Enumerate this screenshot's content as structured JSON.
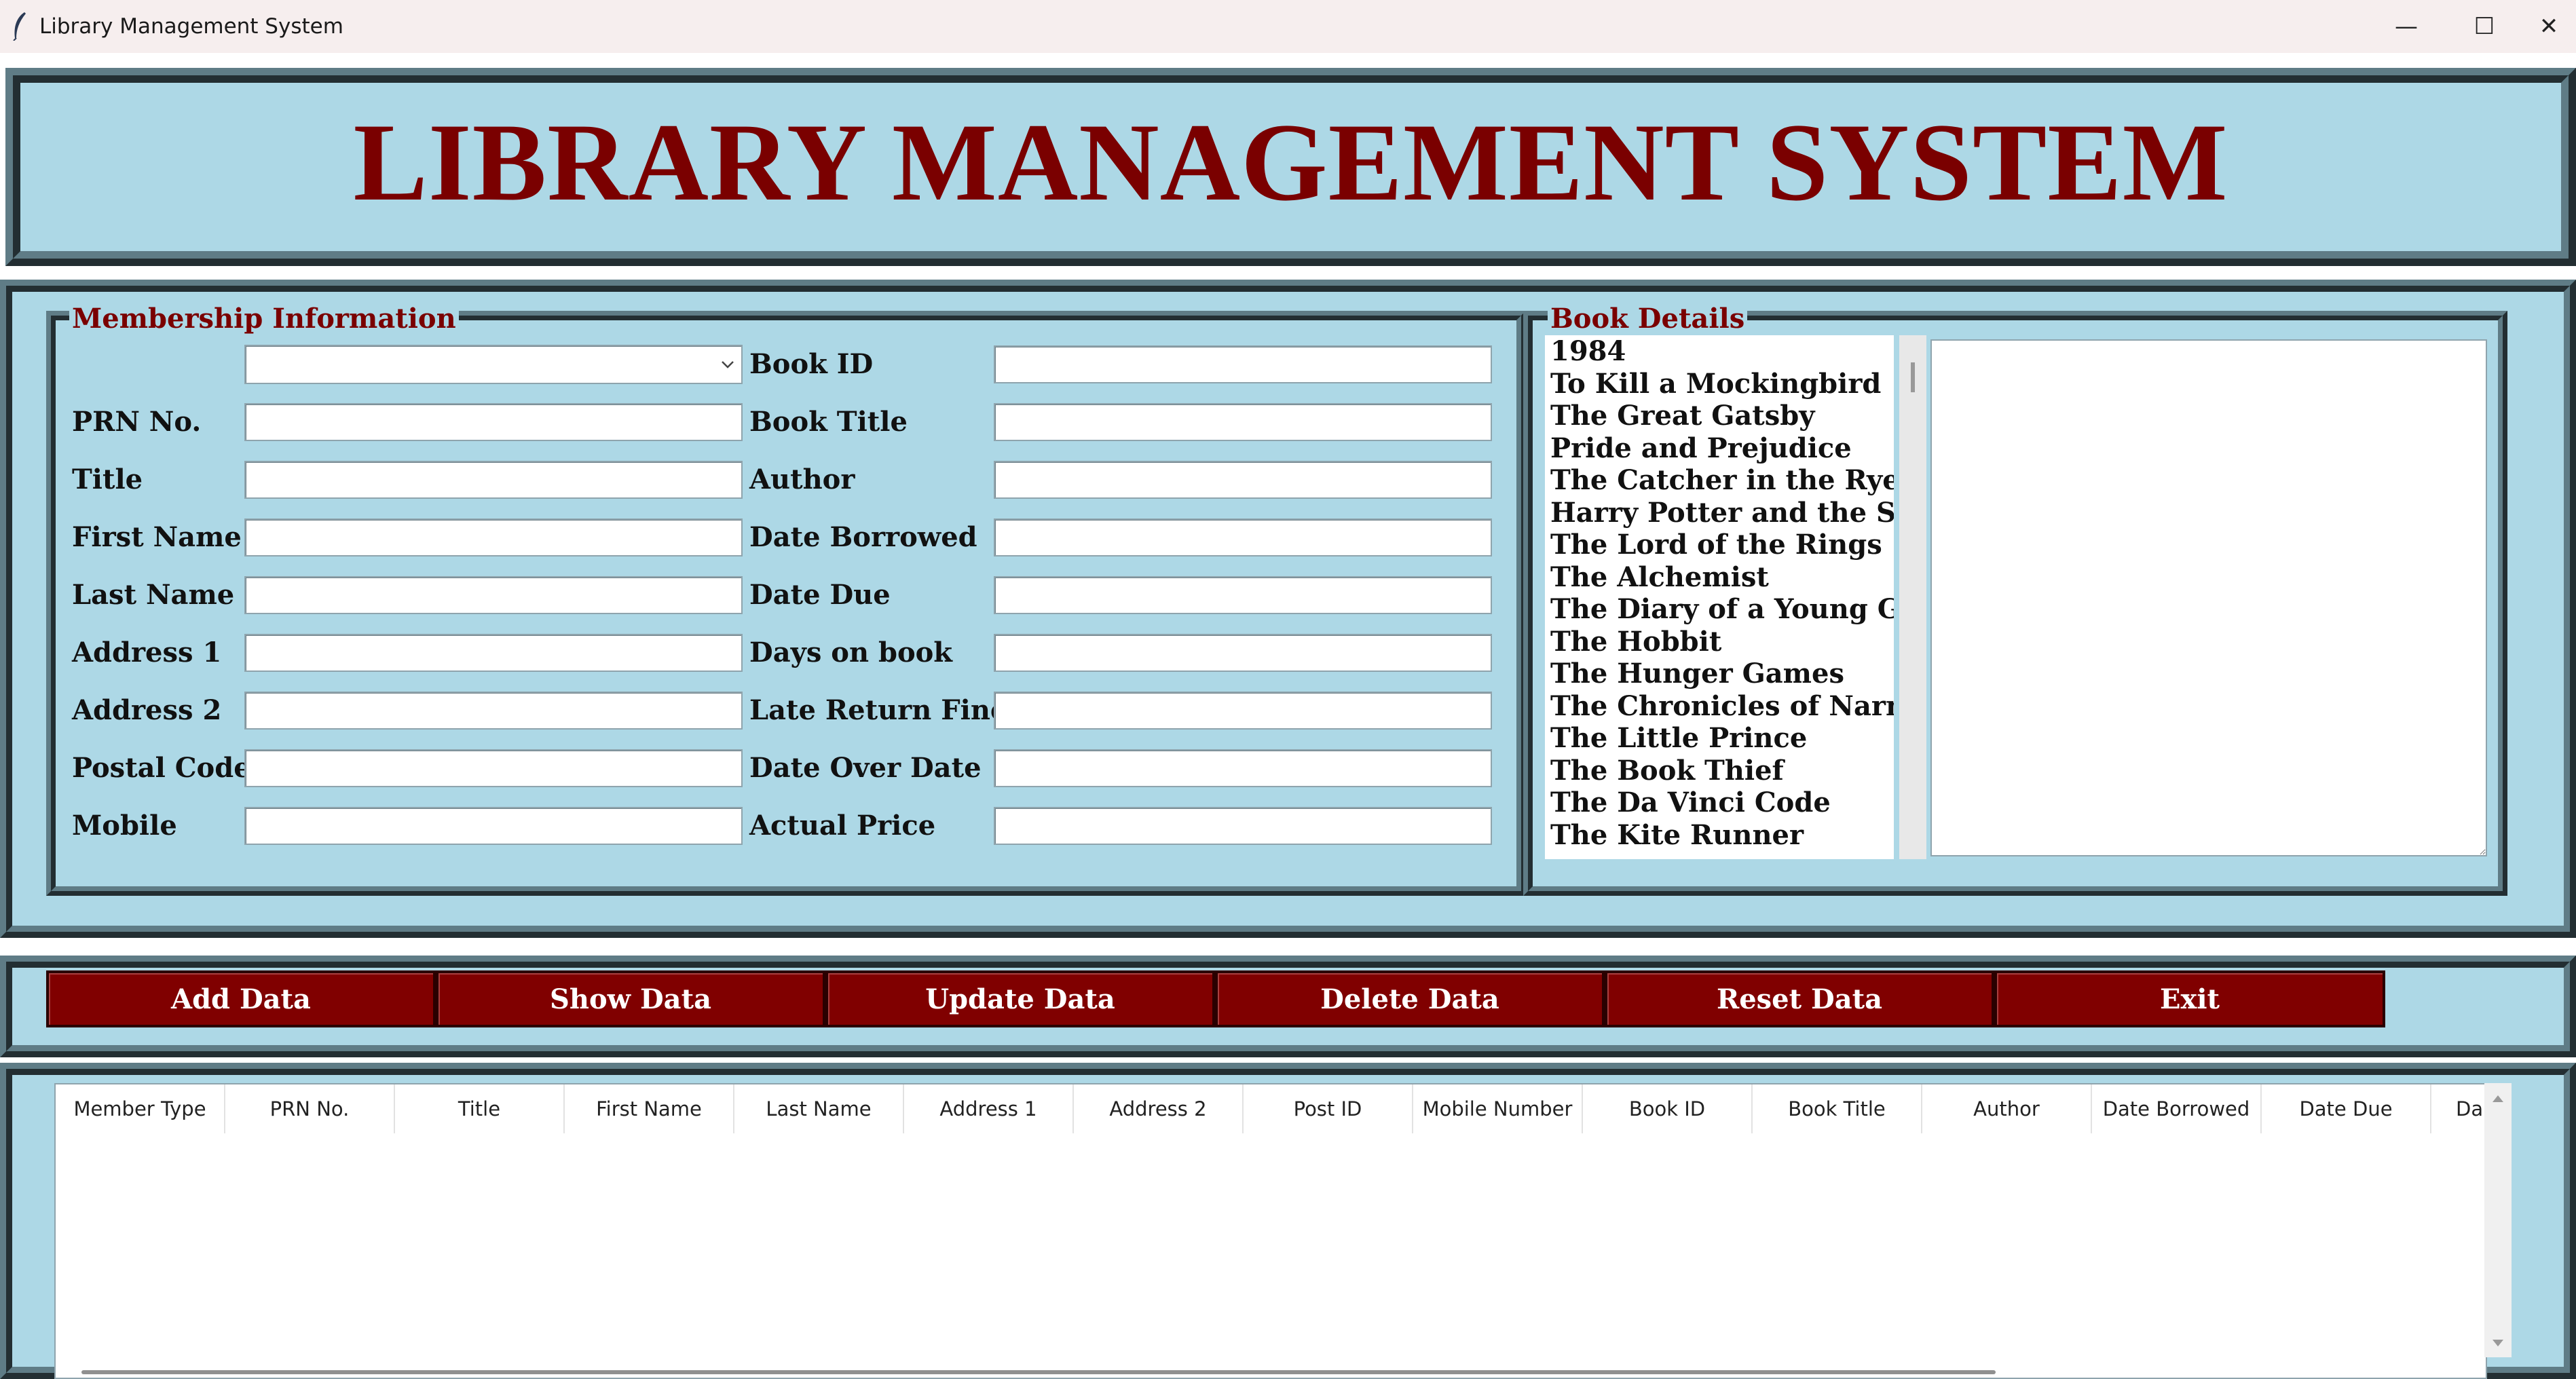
{
  "window": {
    "title": "Library Management System",
    "minimize": "—",
    "maximize": "☐",
    "close": "✕"
  },
  "header": {
    "title": "LIBRARY MANAGEMENT SYSTEM"
  },
  "membership": {
    "legend": "Membership Information",
    "member_type_value": "",
    "left_labels": [
      "PRN No.",
      "Title",
      "First Name",
      "Last Name",
      "Address 1",
      "Address 2",
      "Postal Code",
      "Mobile"
    ],
    "right_labels": [
      "Book ID",
      "Book Title",
      "Author",
      "Date Borrowed",
      "Date Due",
      "Days on book",
      "Late Return Fine",
      "Date Over Date",
      "Actual Price"
    ]
  },
  "book_details": {
    "legend": "Book Details",
    "books": [
      "1984",
      "To Kill a Mockingbird",
      "The Great Gatsby",
      "Pride and Prejudice",
      "The Catcher in the Rye",
      "Harry Potter and the Sor",
      "The Lord of the Rings",
      "The Alchemist",
      "The Diary of a Young Gir",
      "The Hobbit",
      "The Hunger Games",
      "The Chronicles of Narnia",
      "The Little Prince",
      "The Book Thief",
      "The Da Vinci Code",
      "The Kite Runner"
    ]
  },
  "buttons": [
    "Add Data",
    "Show Data",
    "Update Data",
    "Delete Data",
    "Reset Data",
    "Exit"
  ],
  "table": {
    "columns": [
      "Member Type",
      "PRN No.",
      "Title",
      "First Name",
      "Last Name",
      "Address 1",
      "Address 2",
      "Post ID",
      "Mobile Number",
      "Book ID",
      "Book Title",
      "Author",
      "Date Borrowed",
      "Date Due",
      "Da"
    ]
  },
  "colors": {
    "panel": "#add8e6",
    "accent": "#7a0000",
    "button": "#800000"
  }
}
